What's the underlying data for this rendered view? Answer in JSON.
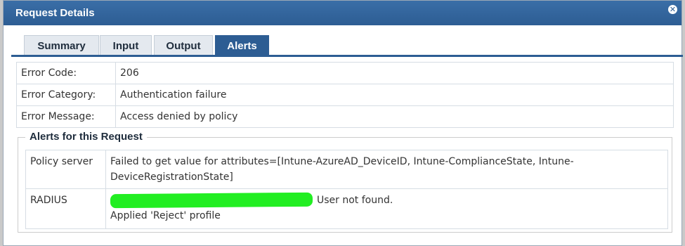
{
  "dialog": {
    "title": "Request Details",
    "close_icon": "close-icon",
    "colors": {
      "titlebar": "#2d5d93",
      "active_tab": "#2d5d93",
      "redaction": "#22ee22"
    }
  },
  "tabs": [
    {
      "label": "Summary",
      "active": false
    },
    {
      "label": "Input",
      "active": false
    },
    {
      "label": "Output",
      "active": false
    },
    {
      "label": "Alerts",
      "active": true
    }
  ],
  "error_info": [
    {
      "label": "Error Code:",
      "value": "206"
    },
    {
      "label": "Error Category:",
      "value": "Authentication failure"
    },
    {
      "label": "Error Message:",
      "value": "Access denied by policy"
    }
  ],
  "alerts_section": {
    "legend": "Alerts for this Request",
    "rows": [
      {
        "source": "Policy server",
        "message": "Failed to get value for attributes=[Intune-AzureAD_DeviceID, Intune-ComplianceState, Intune-DeviceRegistrationState]"
      },
      {
        "source": "RADIUS",
        "message_line1": "User not found.",
        "message_line2": "Applied 'Reject' profile"
      }
    ]
  }
}
